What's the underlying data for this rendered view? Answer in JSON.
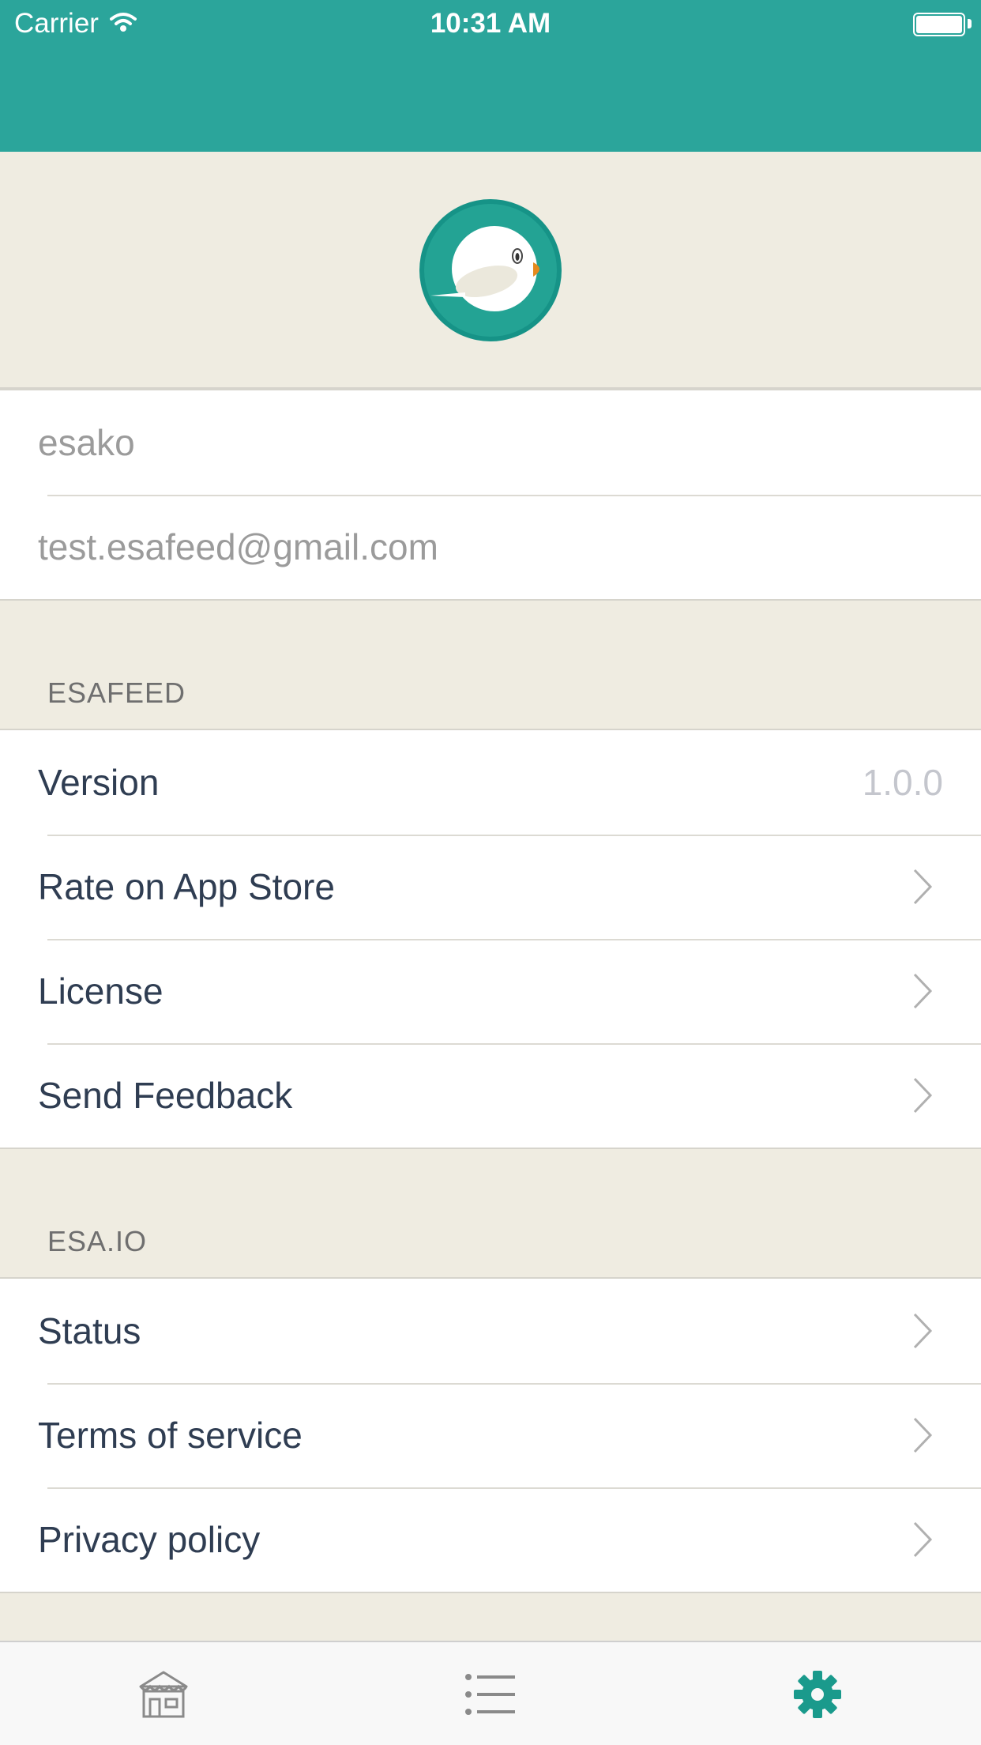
{
  "status_bar": {
    "carrier": "Carrier",
    "time": "10:31 AM"
  },
  "profile": {
    "username": "esako",
    "email": "test.esafeed@gmail.com"
  },
  "sections": {
    "esafeed": {
      "title": "ESAFEED",
      "version_label": "Version",
      "version_value": "1.0.0",
      "items": [
        "Rate on App Store",
        "License",
        "Send Feedback"
      ]
    },
    "esaio": {
      "title": "ESA.IO",
      "items": [
        "Status",
        "Terms of service",
        "Privacy policy"
      ]
    }
  },
  "tab_bar": {
    "tabs": [
      {
        "icon": "home-icon",
        "active": false
      },
      {
        "icon": "list-icon",
        "active": false
      },
      {
        "icon": "gear-icon",
        "active": true
      }
    ]
  },
  "colors": {
    "accent": "#2ba59b",
    "background": "#efece1",
    "text": "#2f3d52",
    "inactive_tab": "#8a8a8a"
  }
}
